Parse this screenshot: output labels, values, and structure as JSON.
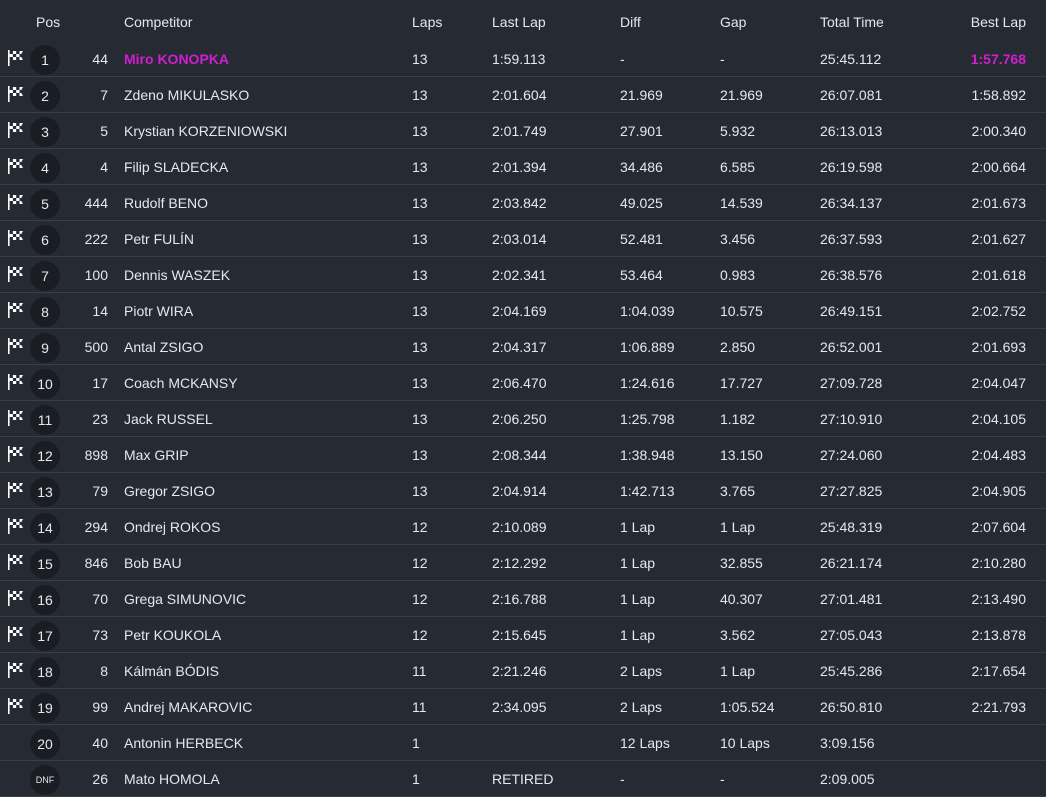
{
  "headers": {
    "pos": "Pos",
    "competitor": "Competitor",
    "laps": "Laps",
    "last_lap": "Last Lap",
    "diff": "Diff",
    "gap": "Gap",
    "total_time": "Total Time",
    "best_lap": "Best Lap"
  },
  "colors": {
    "background": "#262a33",
    "highlight": "#d01fcf",
    "divider": "#3a3f4a",
    "badge": "#1a1d24"
  },
  "icons": {
    "finish": "checkered-flag-icon"
  },
  "rows": [
    {
      "pos": "1",
      "num": "44",
      "name": "Miro KONOPKA",
      "laps": "13",
      "last": "1:59.113",
      "diff": "-",
      "gap": "-",
      "total": "25:45.112",
      "best": "1:57.768",
      "flag": true,
      "leader": true
    },
    {
      "pos": "2",
      "num": "7",
      "name": "Zdeno MIKULASKO",
      "laps": "13",
      "last": "2:01.604",
      "diff": "21.969",
      "gap": "21.969",
      "total": "26:07.081",
      "best": "1:58.892",
      "flag": true
    },
    {
      "pos": "3",
      "num": "5",
      "name": "Krystian KORZENIOWSKI",
      "laps": "13",
      "last": "2:01.749",
      "diff": "27.901",
      "gap": "5.932",
      "total": "26:13.013",
      "best": "2:00.340",
      "flag": true
    },
    {
      "pos": "4",
      "num": "4",
      "name": "Filip SLADECKA",
      "laps": "13",
      "last": "2:01.394",
      "diff": "34.486",
      "gap": "6.585",
      "total": "26:19.598",
      "best": "2:00.664",
      "flag": true
    },
    {
      "pos": "5",
      "num": "444",
      "name": "Rudolf BENO",
      "laps": "13",
      "last": "2:03.842",
      "diff": "49.025",
      "gap": "14.539",
      "total": "26:34.137",
      "best": "2:01.673",
      "flag": true
    },
    {
      "pos": "6",
      "num": "222",
      "name": "Petr FULÍN",
      "laps": "13",
      "last": "2:03.014",
      "diff": "52.481",
      "gap": "3.456",
      "total": "26:37.593",
      "best": "2:01.627",
      "flag": true
    },
    {
      "pos": "7",
      "num": "100",
      "name": "Dennis WASZEK",
      "laps": "13",
      "last": "2:02.341",
      "diff": "53.464",
      "gap": "0.983",
      "total": "26:38.576",
      "best": "2:01.618",
      "flag": true
    },
    {
      "pos": "8",
      "num": "14",
      "name": "Piotr WIRA",
      "laps": "13",
      "last": "2:04.169",
      "diff": "1:04.039",
      "gap": "10.575",
      "total": "26:49.151",
      "best": "2:02.752",
      "flag": true
    },
    {
      "pos": "9",
      "num": "500",
      "name": "Antal ZSIGO",
      "laps": "13",
      "last": "2:04.317",
      "diff": "1:06.889",
      "gap": "2.850",
      "total": "26:52.001",
      "best": "2:01.693",
      "flag": true
    },
    {
      "pos": "10",
      "num": "17",
      "name": "Coach MCKANSY",
      "laps": "13",
      "last": "2:06.470",
      "diff": "1:24.616",
      "gap": "17.727",
      "total": "27:09.728",
      "best": "2:04.047",
      "flag": true
    },
    {
      "pos": "11",
      "num": "23",
      "name": "Jack RUSSEL",
      "laps": "13",
      "last": "2:06.250",
      "diff": "1:25.798",
      "gap": "1.182",
      "total": "27:10.910",
      "best": "2:04.105",
      "flag": true
    },
    {
      "pos": "12",
      "num": "898",
      "name": "Max GRIP",
      "laps": "13",
      "last": "2:08.344",
      "diff": "1:38.948",
      "gap": "13.150",
      "total": "27:24.060",
      "best": "2:04.483",
      "flag": true
    },
    {
      "pos": "13",
      "num": "79",
      "name": "Gregor ZSIGO",
      "laps": "13",
      "last": "2:04.914",
      "diff": "1:42.713",
      "gap": "3.765",
      "total": "27:27.825",
      "best": "2:04.905",
      "flag": true
    },
    {
      "pos": "14",
      "num": "294",
      "name": "Ondrej ROKOS",
      "laps": "12",
      "last": "2:10.089",
      "diff": "1 Lap",
      "gap": "1 Lap",
      "total": "25:48.319",
      "best": "2:07.604",
      "flag": true
    },
    {
      "pos": "15",
      "num": "846",
      "name": "Bob BAU",
      "laps": "12",
      "last": "2:12.292",
      "diff": "1 Lap",
      "gap": "32.855",
      "total": "26:21.174",
      "best": "2:10.280",
      "flag": true
    },
    {
      "pos": "16",
      "num": "70",
      "name": "Grega SIMUNOVIC",
      "laps": "12",
      "last": "2:16.788",
      "diff": "1 Lap",
      "gap": "40.307",
      "total": "27:01.481",
      "best": "2:13.490",
      "flag": true
    },
    {
      "pos": "17",
      "num": "73",
      "name": "Petr KOUKOLA",
      "laps": "12",
      "last": "2:15.645",
      "diff": "1 Lap",
      "gap": "3.562",
      "total": "27:05.043",
      "best": "2:13.878",
      "flag": true
    },
    {
      "pos": "18",
      "num": "8",
      "name": "Kálmán BÓDIS",
      "laps": "11",
      "last": "2:21.246",
      "diff": "2 Laps",
      "gap": "1 Lap",
      "total": "25:45.286",
      "best": "2:17.654",
      "flag": true
    },
    {
      "pos": "19",
      "num": "99",
      "name": "Andrej MAKAROVIC",
      "laps": "11",
      "last": "2:34.095",
      "diff": "2 Laps",
      "gap": "1:05.524",
      "total": "26:50.810",
      "best": "2:21.793",
      "flag": true
    },
    {
      "pos": "20",
      "num": "40",
      "name": "Antonin HERBECK",
      "laps": "1",
      "last": "",
      "diff": "12 Laps",
      "gap": "10 Laps",
      "total": "3:09.156",
      "best": "",
      "flag": false
    },
    {
      "pos": "DNF",
      "num": "26",
      "name": "Mato HOMOLA",
      "laps": "1",
      "last": "RETIRED",
      "diff": "-",
      "gap": "-",
      "total": "2:09.005",
      "best": "",
      "flag": false
    }
  ]
}
